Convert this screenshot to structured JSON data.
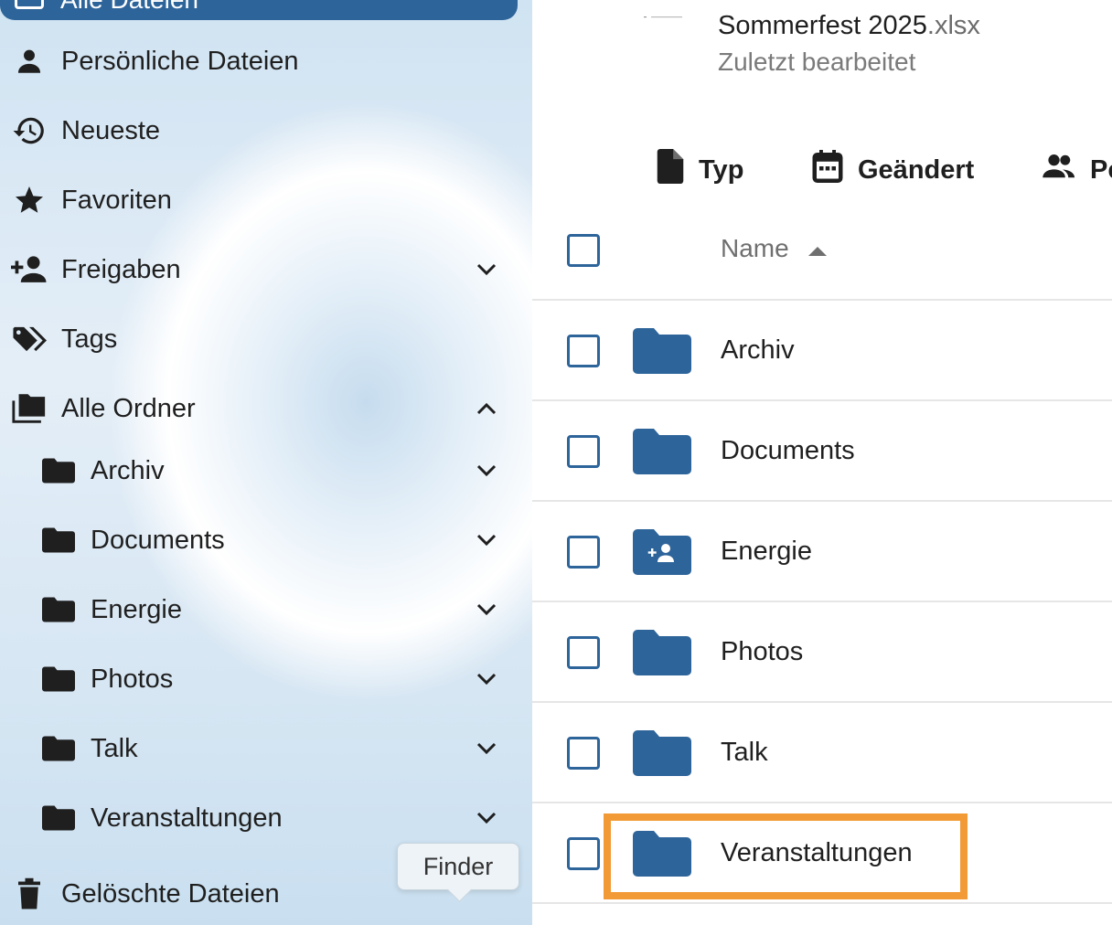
{
  "sidebar": {
    "active_item": {
      "label": "Alle Dateien",
      "icon": "folder-multiple-icon"
    },
    "items": [
      {
        "label": "Persönliche Dateien",
        "icon": "person-icon"
      },
      {
        "label": "Neueste",
        "icon": "history-icon"
      },
      {
        "label": "Favoriten",
        "icon": "star-icon"
      },
      {
        "label": "Freigaben",
        "icon": "share-person-icon",
        "chevron": "down"
      },
      {
        "label": "Tags",
        "icon": "tags-icon"
      },
      {
        "label": "Alle Ordner",
        "icon": "folders-icon",
        "chevron": "up"
      }
    ],
    "folders": [
      {
        "label": "Archiv"
      },
      {
        "label": "Documents"
      },
      {
        "label": "Energie"
      },
      {
        "label": "Photos"
      },
      {
        "label": "Talk"
      },
      {
        "label": "Veranstaltungen"
      }
    ],
    "trash": {
      "label": "Gelöschte Dateien",
      "icon": "trash-icon"
    },
    "tooltip": "Finder"
  },
  "recent": {
    "name": "Sommerfest 2025",
    "ext": ".xlsx",
    "subtitle": "Zuletzt bearbeitet"
  },
  "filters": {
    "type": "Typ",
    "modified": "Geändert",
    "people": "Pe"
  },
  "table": {
    "header_name": "Name",
    "rows": [
      {
        "name": "Archiv",
        "icon": "folder-icon"
      },
      {
        "name": "Documents",
        "icon": "folder-icon"
      },
      {
        "name": "Energie",
        "icon": "shared-folder-icon"
      },
      {
        "name": "Photos",
        "icon": "folder-icon"
      },
      {
        "name": "Talk",
        "icon": "folder-icon"
      },
      {
        "name": "Veranstaltungen",
        "icon": "folder-icon"
      }
    ]
  },
  "colors": {
    "accent": "#2d649a",
    "highlight": "#f29a35"
  }
}
